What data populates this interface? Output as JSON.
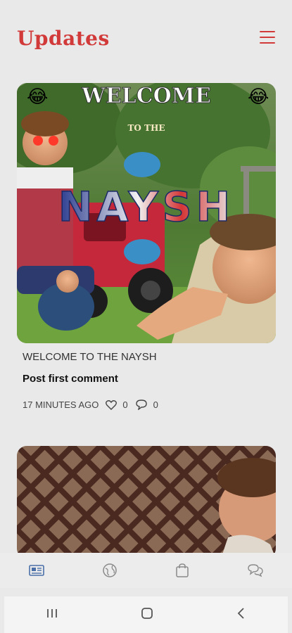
{
  "header": {
    "title": "Updates",
    "menu_icon": "hamburger-menu-icon",
    "accent_color": "#d23a3a"
  },
  "posts": [
    {
      "image_text": {
        "line1": "WELCOME",
        "line2": "TO THE",
        "line3": "NAYSH",
        "emoji_left": "😂",
        "emoji_right": "😂"
      },
      "title": "WELCOME TO THE NAYSH",
      "comment_prompt": "Post first comment",
      "time_ago": "17 MINUTES AGO",
      "likes": "0",
      "comments": "0"
    },
    {
      "image_text": {}
    }
  ],
  "bottom_nav": {
    "items": [
      {
        "name": "news",
        "icon": "newspaper-icon"
      },
      {
        "name": "explore",
        "icon": "globe-icon"
      },
      {
        "name": "shop",
        "icon": "shopping-bag-icon"
      },
      {
        "name": "chat",
        "icon": "chat-bubbles-icon"
      }
    ]
  },
  "system_nav": {
    "items": [
      "recent-apps-icon",
      "home-icon",
      "back-icon"
    ]
  }
}
